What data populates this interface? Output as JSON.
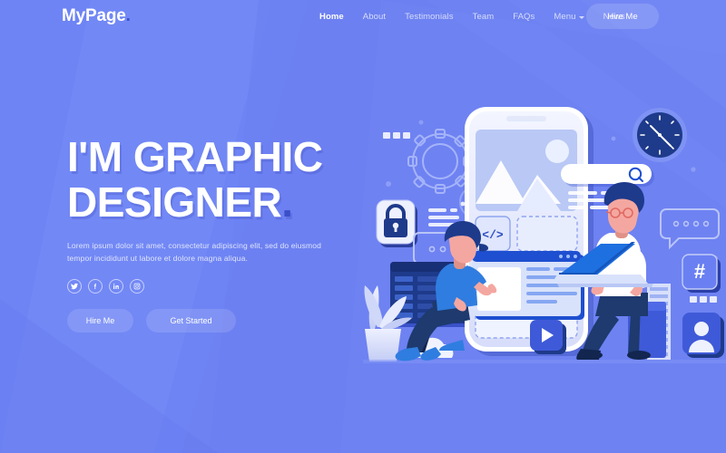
{
  "page": {
    "background_color": "#6e82f2",
    "accent_dark": "#3b50c8"
  },
  "header": {
    "logo_text": "MyPage",
    "logo_dot": ".",
    "nav_items": [
      {
        "label": "Home",
        "active": true,
        "has_chevron": false
      },
      {
        "label": "About",
        "active": false,
        "has_chevron": false
      },
      {
        "label": "Testimonials",
        "active": false,
        "has_chevron": false
      },
      {
        "label": "Team",
        "active": false,
        "has_chevron": false
      },
      {
        "label": "FAQs",
        "active": false,
        "has_chevron": false
      },
      {
        "label": "Menu",
        "active": false,
        "has_chevron": true
      },
      {
        "label": "News",
        "active": false,
        "has_chevron": false
      }
    ],
    "cta_label": "Hire Me"
  },
  "hero": {
    "title_line1": "I'M GRAPHIC",
    "title_line2": "DESIGNER",
    "title_dot": ".",
    "paragraph": "Lorem ipsum dolor sit amet, consectetur adipiscing elit, sed do eiusmod tempor incididunt ut labore et dolore magna aliqua.",
    "socials": [
      {
        "name": "twitter-icon",
        "label": "Twitter"
      },
      {
        "name": "facebook-icon",
        "label": "Facebook"
      },
      {
        "name": "linkedin-icon",
        "label": "LinkedIn"
      },
      {
        "name": "instagram-icon",
        "label": "Instagram"
      }
    ],
    "primary_button": "Hire Me",
    "secondary_button": "Get Started"
  },
  "illustration": {
    "description": "Two designers building a mobile app interface",
    "elements": [
      "smartphone-mockup",
      "image-placeholder",
      "code-block-icon",
      "dashed-placeholder",
      "browser-window",
      "search-bar",
      "analog-clock",
      "lock-icon",
      "chat-bubble",
      "terminal-window",
      "potted-plant",
      "cloud-shape",
      "play-button",
      "hashtag-icon",
      "user-avatar-icon",
      "gear-icon",
      "kneeling-designer",
      "seated-developer",
      "laptop"
    ],
    "code_symbol": "</>",
    "hashtag_symbol": "#"
  }
}
